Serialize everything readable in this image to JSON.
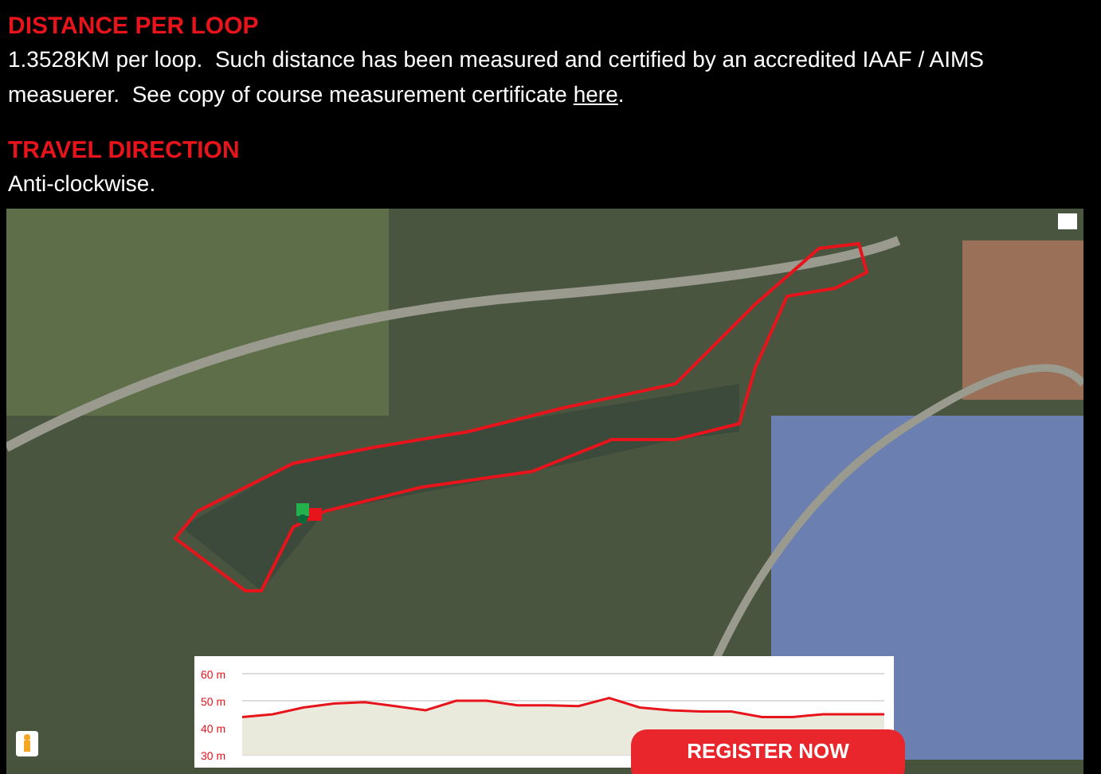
{
  "sections": [
    {
      "heading": "DISTANCE PER LOOP",
      "text": "1.3528KM per loop.  Such distance has been measured and certified by an accredited IAAF / AIMS measuerer.  See copy of course measurement certificate ",
      "link": "here",
      "text_after": "."
    },
    {
      "heading": "TRAVEL DIRECTION",
      "text": "Anti-clockwise."
    }
  ],
  "map": {
    "elevation": {
      "chart_data": {
        "type": "area",
        "ylim": [
          30,
          60
        ],
        "yticks": [
          {
            "value": 60,
            "label": "60 m"
          },
          {
            "value": 50,
            "label": "50 m"
          },
          {
            "value": 40,
            "label": "40 m"
          },
          {
            "value": 30,
            "label": "30 m"
          }
        ],
        "series": [
          {
            "color": "#e8141c",
            "values": [
              44,
              45,
              47.5,
              49,
              49.5,
              48,
              46.5,
              50,
              50,
              48.3,
              48.3,
              48,
              51,
              47.5,
              46.5,
              46,
              46,
              44,
              44,
              45,
              45,
              45
            ]
          }
        ]
      }
    }
  },
  "register_button": "REGISTER NOW"
}
